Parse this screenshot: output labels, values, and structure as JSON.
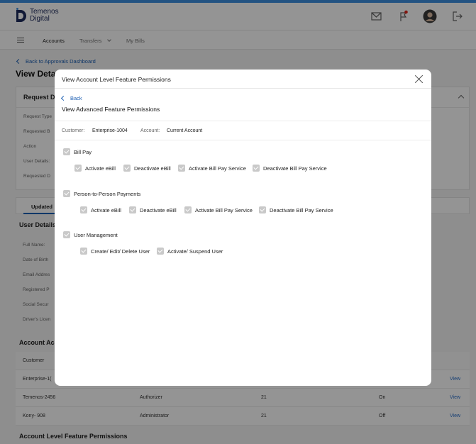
{
  "header": {
    "logo_line1": "Temenos",
    "logo_line2": "Digital",
    "icons": [
      "mail-icon",
      "flag-notification-icon",
      "user-avatar",
      "logout-icon"
    ],
    "accent_color": "#3d8fe0"
  },
  "nav": {
    "items": [
      "Accounts",
      "Transfers",
      "My Bills"
    ]
  },
  "background": {
    "back_link": "Back to Approvals Dashboard",
    "page_title": "View Deta",
    "request_section": "Request De",
    "request_fields": [
      "Request Type",
      "Requested B",
      "Action",
      "User Details:",
      "Requested D"
    ],
    "tab_label": "Updated",
    "user_details_title": "User Details",
    "user_fields": [
      "Full Name:",
      "Date of Birth",
      "Email Addres",
      "Registered P",
      "Social Secur",
      "Driver's Licen"
    ],
    "account_access_title": "Account Acc",
    "table_header_customer": "Customer",
    "rows": [
      {
        "customer": "Enterprise-1(",
        "role": "",
        "count": "",
        "status": "",
        "action": "View"
      },
      {
        "customer": "Temenos-2456",
        "role": "Authorizer",
        "count": "21",
        "status": "On",
        "action": "View"
      },
      {
        "customer": "Kony- 908",
        "role": "Administrator",
        "count": "21",
        "status": "Off",
        "action": "View"
      }
    ],
    "footer_section": "Account Level Feature Permissions"
  },
  "modal": {
    "title": "View Account Level Feature Permissions",
    "back_label": "Back",
    "subtitle": "View Advanced Feature Permissions",
    "customer_label": "Customer:",
    "customer_value": "Enterprise-1004",
    "account_label": "Account:",
    "account_value": "Current Account",
    "groups": [
      {
        "name": "Bill Pay",
        "checked": true,
        "items": [
          "Activate eBill",
          "Deactivate eBill",
          "Activate Bill Pay Service",
          "Deactivate Bill Pay Service"
        ]
      },
      {
        "name": "Person-to-Person Payments",
        "checked": true,
        "items": [
          "Activate eBill",
          "Deactivate eBill",
          "Activate Bill Pay Service",
          "Deactivate Bill Pay Service"
        ]
      },
      {
        "name": "User Management",
        "checked": true,
        "items": [
          "Create/ Edit/ Delete User",
          "Activate/ Suspend User"
        ]
      }
    ]
  }
}
